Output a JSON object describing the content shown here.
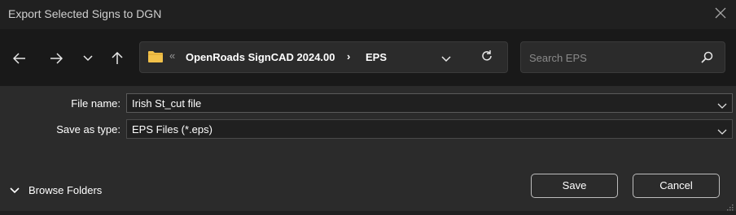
{
  "window": {
    "title": "Export Selected Signs to DGN"
  },
  "address_bar": {
    "crumbs": [
      "OpenRoads SignCAD 2024.00",
      "EPS"
    ]
  },
  "search": {
    "placeholder": "Search EPS"
  },
  "form": {
    "file_name_label": "File name:",
    "file_name_value": "Irish St_cut file",
    "save_type_label": "Save as type:",
    "save_type_value": "EPS Files (*.eps)"
  },
  "footer": {
    "browse_label": "Browse Folders",
    "save_label": "Save",
    "cancel_label": "Cancel"
  },
  "colors": {
    "folder": "#f2c14a",
    "background": "#202020",
    "panel": "#2b2b2b"
  },
  "icons": [
    "close-icon",
    "back-arrow-icon",
    "forward-arrow-icon",
    "chevron-down-icon",
    "up-arrow-icon",
    "folder-icon",
    "refresh-icon",
    "search-icon",
    "grip-icon"
  ]
}
